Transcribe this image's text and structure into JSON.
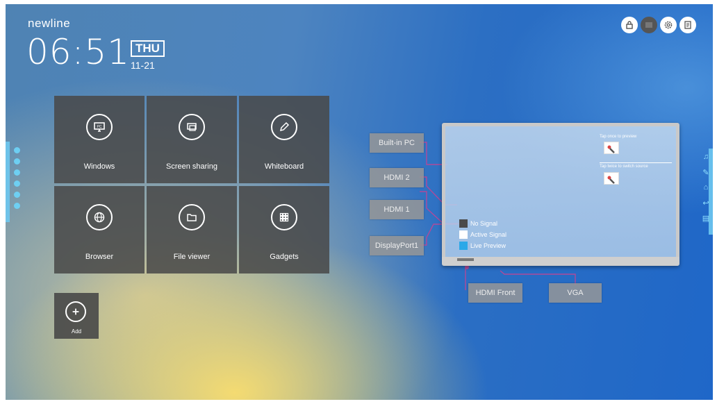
{
  "brand": "newline",
  "clock": {
    "time": "06:51",
    "day": "THU",
    "date": "11-21"
  },
  "top_icons": [
    "lock-icon",
    "screen-icon",
    "settings-gear-icon",
    "notes-icon"
  ],
  "apps": [
    {
      "label": "Windows",
      "icon": "pc-monitor-icon"
    },
    {
      "label": "Screen sharing",
      "icon": "screen-share-icon"
    },
    {
      "label": "Whiteboard",
      "icon": "pencil-icon"
    },
    {
      "label": "Browser",
      "icon": "globe-icon"
    },
    {
      "label": "File viewer",
      "icon": "folder-icon"
    },
    {
      "label": "Gadgets",
      "icon": "grid-apps-icon"
    }
  ],
  "add": {
    "label": "Add"
  },
  "sources": {
    "builtin_pc": "Built-in PC",
    "hdmi2": "HDMI 2",
    "hdmi1": "HDMI 1",
    "displayport1": "DisplayPort1",
    "hdmi_front": "HDMI Front",
    "vga": "VGA"
  },
  "monitor": {
    "hint_preview": "Tap once to preview",
    "hint_switch": "Tap twice to switch source",
    "legend": [
      {
        "label": "No Signal",
        "color": "#4a4a4a"
      },
      {
        "label": "Active Signal",
        "color": "#ffffff"
      },
      {
        "label": "Live Preview",
        "color": "#2aa8e8"
      }
    ]
  },
  "colors": {
    "tile_bg": "#484848",
    "connector": "#b04a9a",
    "accent_cyan": "#6ecff0"
  }
}
